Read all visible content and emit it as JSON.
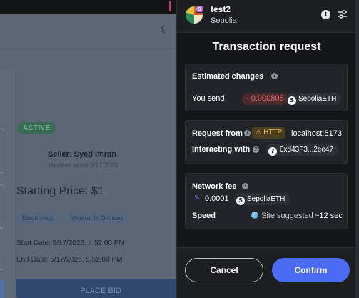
{
  "background_page": {
    "status_badge": "ACTIVE",
    "seller": "Seller: Syed Imran",
    "member_since": "Member since 5/17/2025",
    "starting_price": "Starting Price: $1",
    "tags": [
      "Electronics",
      "Wearable Devices"
    ],
    "start_date": "Start Date: 5/17/2025, 4:52:00 PM",
    "end_date": "End Date: 5/17/2025, 5:52:00 PM",
    "place_bid_label": "PLACE BID",
    "theme_icon": "moon-icon"
  },
  "wallet": {
    "account_name": "test2",
    "network_name": "Sepolia",
    "title": "Transaction request",
    "estimated_changes": {
      "label": "Estimated changes",
      "send_label": "You send",
      "amount": "- 0.000805",
      "token_symbol_letter": "S",
      "token": "SepoliaETH"
    },
    "request": {
      "request_from_label": "Request from",
      "protocol": "HTTP",
      "origin": "localhost:5173",
      "interacting_label": "Interacting with",
      "contract_icon": "?",
      "contract_address": "0xd43F3...2ee47"
    },
    "fee": {
      "network_fee_label": "Network fee",
      "fee_amount": "0.0001",
      "fee_token_letter": "S",
      "fee_token": "SepoliaETH",
      "speed_label": "Speed",
      "speed_value": "Site suggested",
      "speed_time": "~12 sec"
    },
    "buttons": {
      "cancel": "Cancel",
      "confirm": "Confirm"
    },
    "colors": {
      "confirm_bg": "#4c6bf5",
      "amount_negative": "#e36a6f",
      "http_warning": "#f3c54d"
    }
  }
}
